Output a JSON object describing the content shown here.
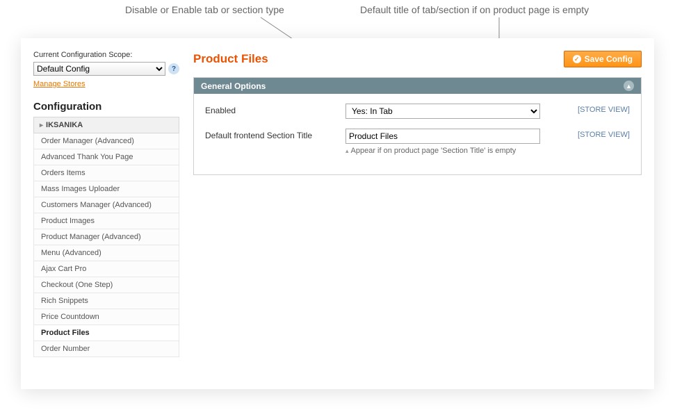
{
  "annotations": {
    "left": "Disable or Enable tab or section type",
    "right": "Default title of tab/section if on product page is empty"
  },
  "scope": {
    "label": "Current Configuration Scope:",
    "selected": "Default Config",
    "manage_link": "Manage Stores"
  },
  "sidebar": {
    "title": "Configuration",
    "group": "IKSANIKA",
    "items": [
      {
        "label": "Order Manager (Advanced)",
        "active": false
      },
      {
        "label": "Advanced Thank You Page",
        "active": false
      },
      {
        "label": "Orders Items",
        "active": false
      },
      {
        "label": "Mass Images Uploader",
        "active": false
      },
      {
        "label": "Customers Manager (Advanced)",
        "active": false
      },
      {
        "label": "Product Images",
        "active": false
      },
      {
        "label": "Product Manager (Advanced)",
        "active": false
      },
      {
        "label": "Menu (Advanced)",
        "active": false
      },
      {
        "label": "Ajax Cart Pro",
        "active": false
      },
      {
        "label": "Checkout (One Step)",
        "active": false
      },
      {
        "label": "Rich Snippets",
        "active": false
      },
      {
        "label": "Price Countdown",
        "active": false
      },
      {
        "label": "Product Files",
        "active": true
      },
      {
        "label": "Order Number",
        "active": false
      }
    ]
  },
  "page": {
    "title": "Product Files",
    "save_label": "Save Config"
  },
  "fieldset": {
    "title": "General Options",
    "rows": {
      "enabled": {
        "label": "Enabled",
        "value": "Yes: In Tab",
        "scope": "[STORE VIEW]"
      },
      "default_title": {
        "label": "Default frontend Section Title",
        "value": "Product Files",
        "note": "Appear if on product page 'Section Title' is empty",
        "scope": "[STORE VIEW]"
      }
    }
  }
}
